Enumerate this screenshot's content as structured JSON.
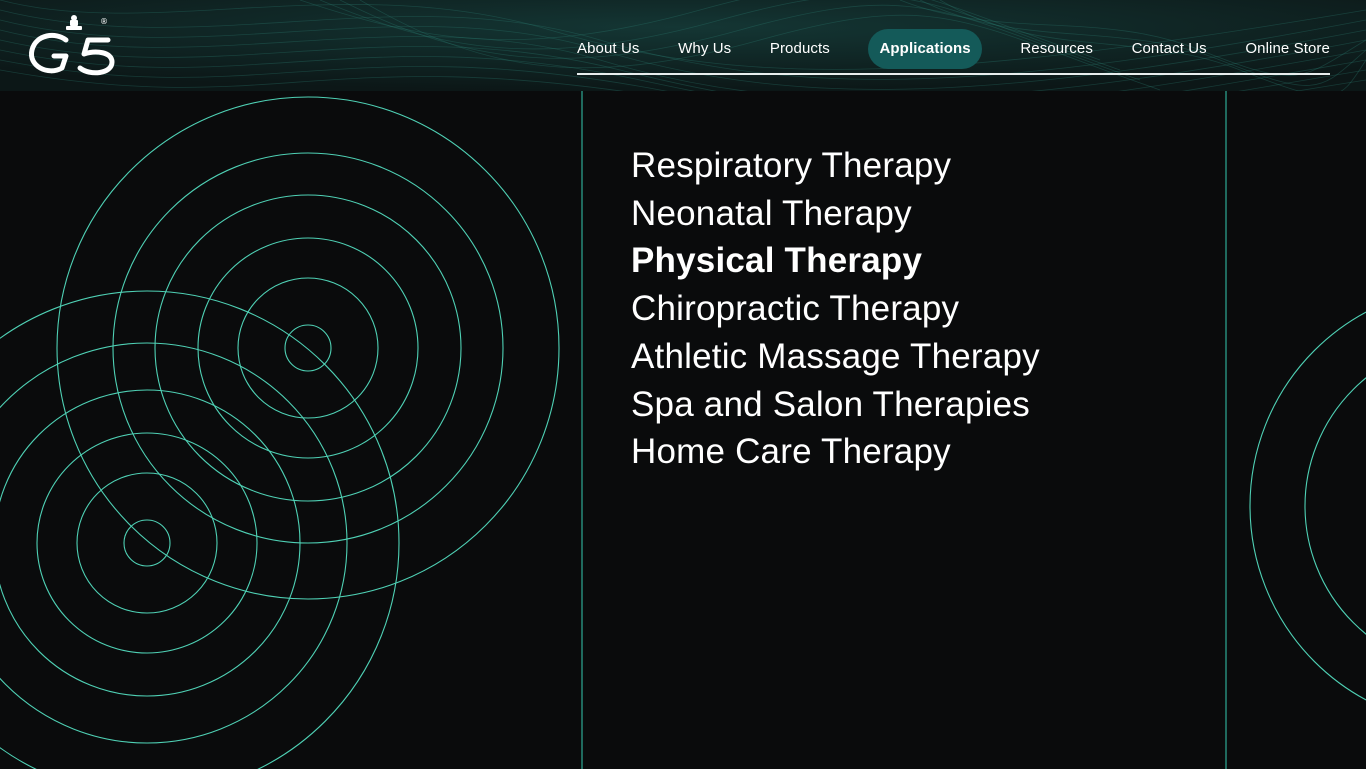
{
  "header": {
    "logo_text": "G5",
    "logo_mark": "®",
    "nav": [
      {
        "label": "About Us",
        "active": false
      },
      {
        "label": "Why Us",
        "active": false
      },
      {
        "label": "Products",
        "active": false
      },
      {
        "label": "Applications",
        "active": true
      },
      {
        "label": "Resources",
        "active": false
      },
      {
        "label": "Contact Us",
        "active": false
      },
      {
        "label": "Online Store",
        "active": false
      }
    ]
  },
  "menu": {
    "items": [
      {
        "label": "Respiratory Therapy",
        "active": false
      },
      {
        "label": "Neonatal Therapy",
        "active": false
      },
      {
        "label": "Physical Therapy",
        "active": true
      },
      {
        "label": "Chiropractic Therapy",
        "active": false
      },
      {
        "label": "Athletic Massage Therapy",
        "active": false
      },
      {
        "label": "Spa and Salon Therapies",
        "active": false
      },
      {
        "label": "Home Care Therapy",
        "active": false
      }
    ]
  },
  "colors": {
    "background": "#0a0b0c",
    "accent": "#4fd1b5",
    "nav_active_bg": "#145a59",
    "text": "#ffffff"
  }
}
